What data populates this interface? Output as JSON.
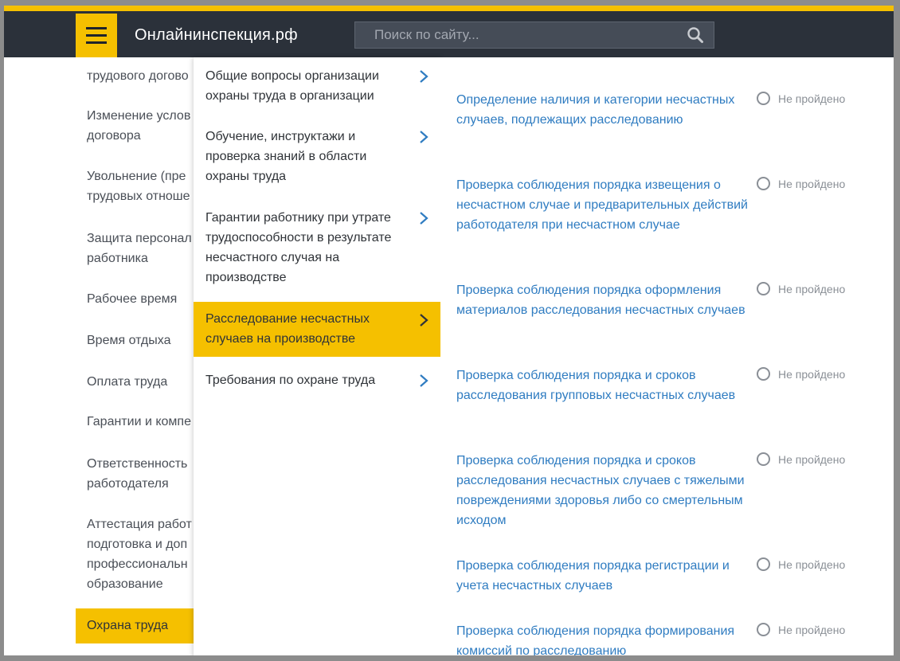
{
  "header": {
    "logo": "Онлайнинспекция.рф",
    "search_placeholder": "Поиск по сайту..."
  },
  "colors": {
    "accent": "#f5c000",
    "header_bg": "#2b313a",
    "link": "#2f7cc1"
  },
  "col1": {
    "items": [
      {
        "label": "трудового догово",
        "active": false
      },
      {
        "label": "Изменение услов\nдоговора",
        "active": false
      },
      {
        "label": "Увольнение (пре\nтрудовых отноше",
        "active": false
      },
      {
        "label": "Защита персонал\nработника",
        "active": false
      },
      {
        "label": "Рабочее время",
        "active": false
      },
      {
        "label": "Время отдыха",
        "active": false
      },
      {
        "label": "Оплата труда",
        "active": false
      },
      {
        "label": "Гарантии и компе",
        "active": false
      },
      {
        "label": "Ответственность\nработодателя",
        "active": false
      },
      {
        "label": "Аттестация работ\nподготовка и доп\nпрофессиональн\nобразование",
        "active": false
      },
      {
        "label": "Охрана труда",
        "active": true
      }
    ]
  },
  "col2": {
    "items": [
      {
        "label": "Общие вопросы организации охраны труда в организации",
        "active": false
      },
      {
        "label": "Обучение, инструктажи и проверка знаний в области охраны труда",
        "active": false
      },
      {
        "label": "Гарантии работнику при утрате трудоспособности в результате несчастного случая на производстве",
        "active": false
      },
      {
        "label": "Расследование несчастных случаев на производстве",
        "active": true
      },
      {
        "label": "Требования по охране труда",
        "active": false
      }
    ]
  },
  "col3": {
    "status_label": "Не пройдено",
    "items": [
      {
        "label": "Определение наличия и категории несчастных случаев, подлежащих расследованию"
      },
      {
        "label": "Проверка соблюдения порядка извещения о несчастном случае и предварительных действий работодателя при несчастном случае"
      },
      {
        "label": "Проверка соблюдения порядка оформления материалов расследования несчастных случаев"
      },
      {
        "label": "Проверка соблюдения порядка и сроков расследования групповых несчастных случаев"
      },
      {
        "label": "Проверка соблюдения порядка и сроков расследования несчастных случаев с тяжелыми повреждениями здоровья либо со смертельным исходом"
      },
      {
        "label": "Проверка соблюдения порядка регистрации и учета несчастных случаев"
      },
      {
        "label": "Проверка соблюдения порядка формирования комиссий по расследованию"
      }
    ]
  }
}
